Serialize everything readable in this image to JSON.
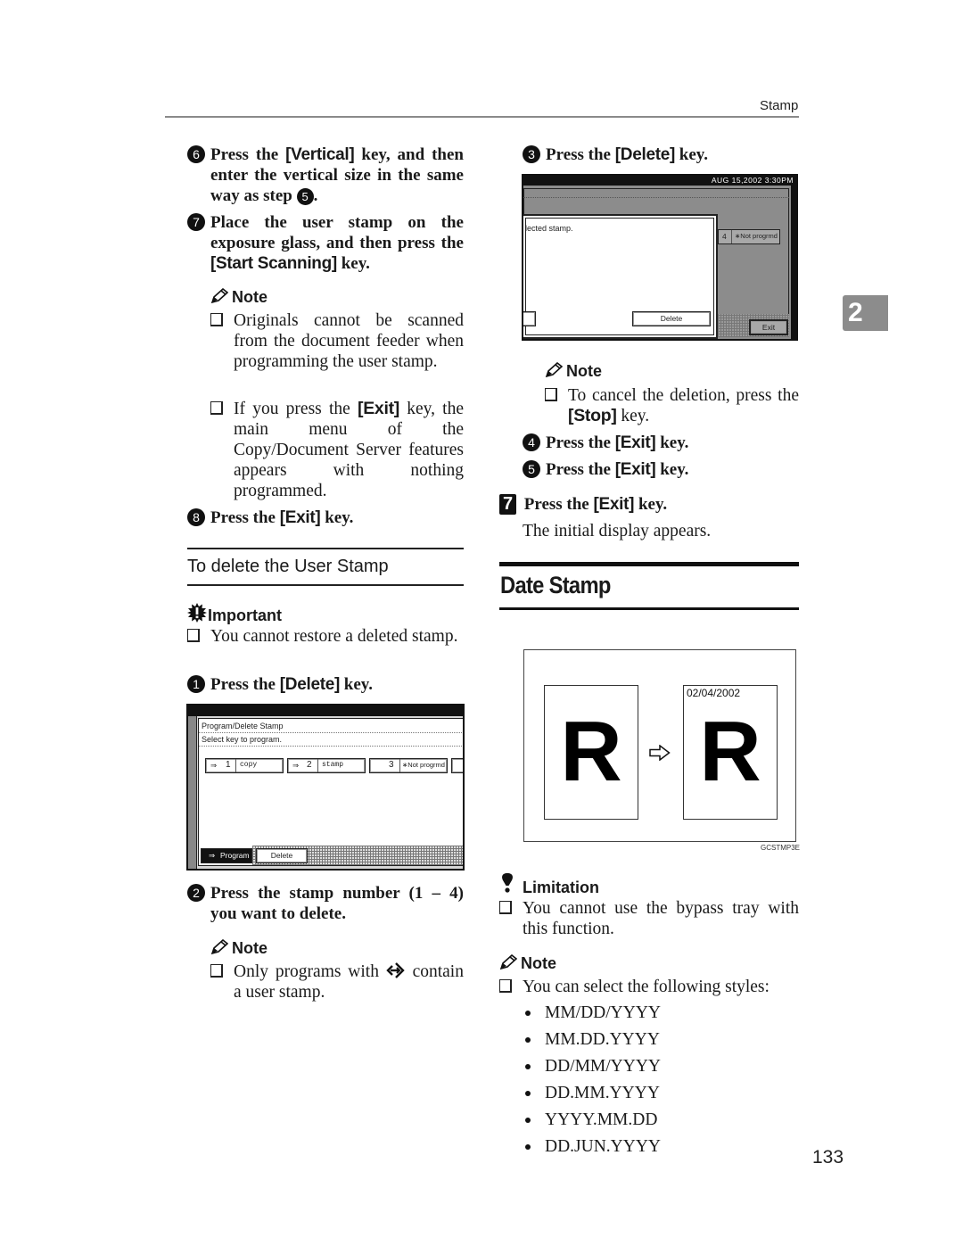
{
  "header": {
    "running_head": "Stamp"
  },
  "chapter_tab": "2",
  "left_column": {
    "step6": {
      "num": "6",
      "pre": "Press the ",
      "key": "[Vertical]",
      "post": " key, and then enter the vertical size in the same way as step ",
      "ref": "5",
      "end": "."
    },
    "step7": {
      "num": "7",
      "pre": "Place the user stamp on the exposure glass, and then press the ",
      "key": "[Start Scanning]",
      "post": " key."
    },
    "note1": {
      "title": "Note",
      "items": [
        {
          "text": "Originals cannot be scanned from the document feeder when programming the user stamp."
        },
        {
          "pre": "If you press the ",
          "key": "[Exit]",
          "post": " key, the main menu of the Copy/Document Server features appears with nothing programmed."
        }
      ]
    },
    "step8": {
      "num": "8",
      "pre": "Press the ",
      "key": "[Exit]",
      "post": " key."
    },
    "subsection_title": "To delete the User Stamp",
    "important": {
      "title": "Important",
      "items": [
        "You cannot restore a deleted stamp."
      ]
    },
    "del_step1": {
      "num": "1",
      "pre": "Press the ",
      "key": "[Delete]",
      "post": " key."
    },
    "screen1": {
      "title": "Program/Delete Stamp",
      "instruction": "Select key to program.",
      "stamps": [
        {
          "number": "1",
          "name": "copy",
          "programmed": true
        },
        {
          "number": "2",
          "name": "stamp",
          "programmed": true
        },
        {
          "number": "3",
          "name": "∗Not progrmd",
          "programmed": false
        }
      ],
      "program_button": "Program",
      "delete_button": "Delete"
    },
    "del_step2": {
      "num": "2",
      "text": "Press the stamp number (1 – 4) you want to delete."
    },
    "note2": {
      "title": "Note",
      "pre": "Only programs with ",
      "post": " contain a user stamp."
    }
  },
  "right_column": {
    "del_step3": {
      "num": "3",
      "pre": "Press the ",
      "key": "[Delete]",
      "post": " key."
    },
    "screen2": {
      "datetime": "AUG  15,2002  3:30PM",
      "dialog_text": "lected stamp.",
      "delete_button": "Delete",
      "bg_stamp_number": "4",
      "bg_stamp_name": "∗Not progrmd",
      "exit_button": "Exit"
    },
    "note3": {
      "title": "Note",
      "pre": "To cancel the deletion, press the ",
      "key": "[Stop]",
      "post": " key."
    },
    "del_step4": {
      "num": "4",
      "pre": "Press the ",
      "key": "[Exit]",
      "post": " key."
    },
    "del_step5": {
      "num": "5",
      "pre": "Press the ",
      "key": "[Exit]",
      "post": " key."
    },
    "main_step7": {
      "num": "7",
      "pre": "Press the ",
      "key": "[Exit]",
      "post": " key.",
      "result": "The initial display appears."
    },
    "section_title": "Date Stamp",
    "figure": {
      "letter": "R",
      "stamp_date": "02/04/2002",
      "code": "GCSTMP3E"
    },
    "limitation": {
      "title": "Limitation",
      "items": [
        "You cannot use the bypass tray with this function."
      ]
    },
    "note4": {
      "title": "Note",
      "intro": "You can select the following styles:",
      "styles": [
        "MM/DD/YYYY",
        "MM.DD.YYYY",
        "DD/MM/YYYY",
        "DD.MM.YYYY",
        "YYYY.MM.DD",
        "DD.JUN.YYYY"
      ]
    }
  },
  "page_number": "133"
}
